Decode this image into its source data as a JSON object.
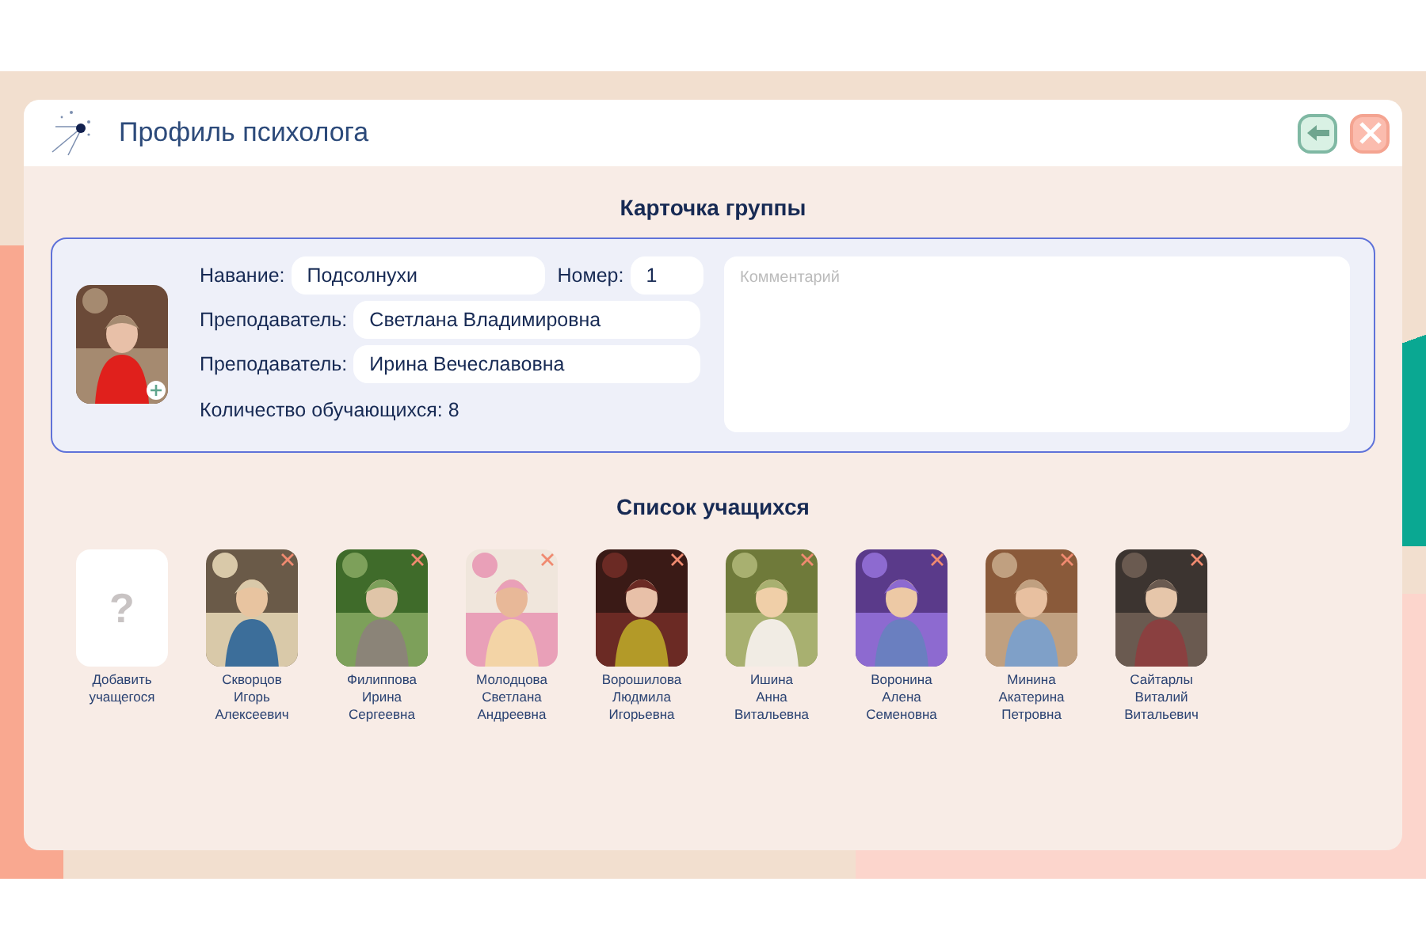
{
  "window": {
    "title": "Профиль психолога"
  },
  "header_buttons": [
    {
      "kind": "back"
    },
    {
      "kind": "close"
    }
  ],
  "group_card": {
    "title": "Карточка группы",
    "fields": [
      {
        "label": "Навание:",
        "value": "Подсолнухи"
      },
      {
        "label": "Номер:",
        "value": "1"
      },
      {
        "label": "Преподаватель:",
        "value": "Светлана Владимировна"
      },
      {
        "label": "Преподаватель:",
        "value": "Ирина Вечеславовна"
      }
    ],
    "count_text": "Количество обучающихся: 8",
    "comment": {
      "placeholder": "Комментарий"
    }
  },
  "students_section": {
    "title": "Список учащихся",
    "add_button": {
      "icon_text": "?",
      "label": "Добавить\nучащегося"
    },
    "students": [
      {
        "name": "Скворцов\nИгорь\nАлексеевич"
      },
      {
        "name": "Филиппова\nИрина\nСергеевна"
      },
      {
        "name": "Молодцова\nСветлана\nАндреевна"
      },
      {
        "name": "Ворошилова\nЛюдмила\nИгорьевна"
      },
      {
        "name": "Ишина\nАнна\nВитальевна"
      },
      {
        "name": "Воронина\nАлена\nСеменовна"
      },
      {
        "name": "Минина\nАкатерина\nПетровна"
      },
      {
        "name": "Сайтарлы\nВиталий\nВитальевич"
      }
    ]
  }
}
